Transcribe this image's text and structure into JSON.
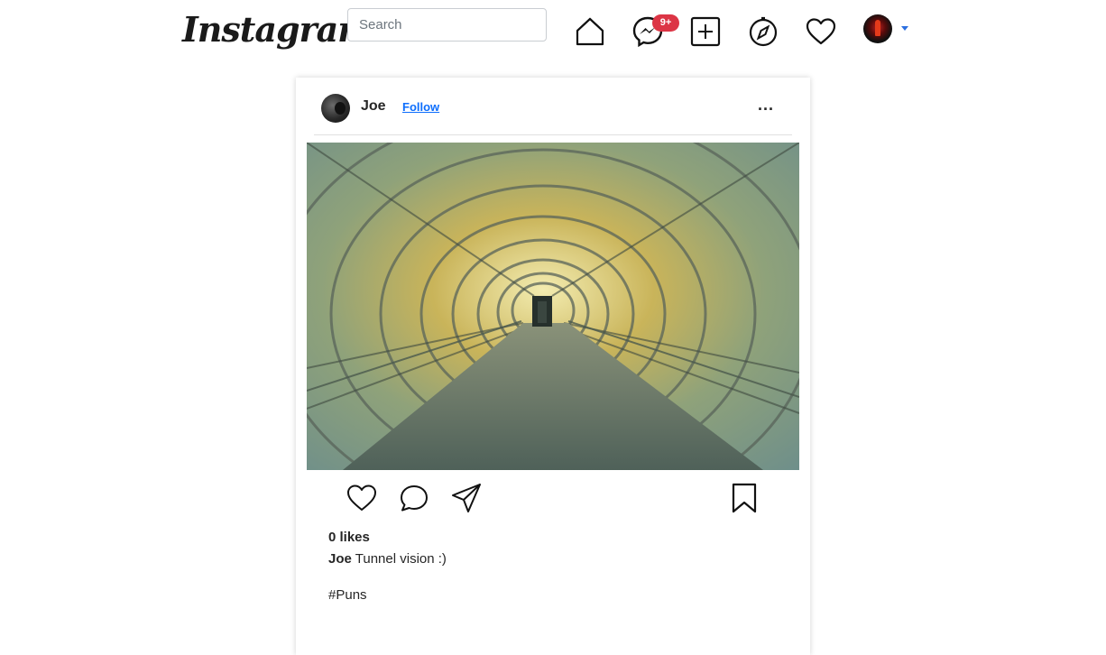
{
  "nav": {
    "logo_text": "Instagram",
    "search_placeholder": "Search",
    "messages_badge": "9+"
  },
  "post": {
    "username": "Joe",
    "follow_label": "Follow",
    "more_label": "...",
    "likes_text": "0 likes",
    "caption_user": "Joe",
    "caption_text": "Tunnel vision :)",
    "hashtag": "#Puns"
  },
  "colors": {
    "badge": "#dc3545",
    "follow_link": "#0d6efd"
  },
  "icons": {
    "nav": [
      "home-icon",
      "messenger-icon",
      "new-post-icon",
      "explore-compass-icon",
      "activity-heart-icon",
      "profile-avatar"
    ],
    "post_actions": [
      "like-heart-icon",
      "comment-icon",
      "share-icon",
      "bookmark-icon"
    ]
  }
}
